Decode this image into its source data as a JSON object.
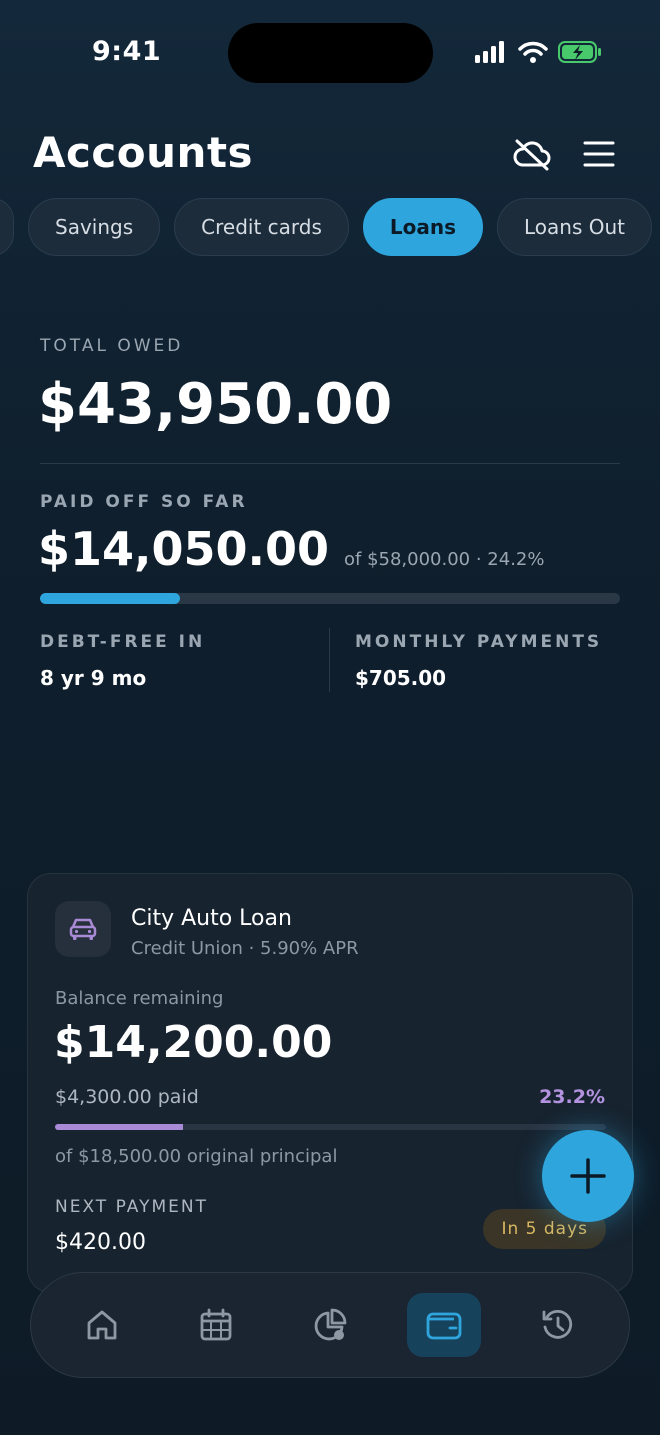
{
  "status_bar": {
    "time": "9:41"
  },
  "header": {
    "title": "Accounts"
  },
  "tabs": [
    {
      "label": ""
    },
    {
      "label": "Savings"
    },
    {
      "label": "Credit cards"
    },
    {
      "label": "Loans",
      "active": true
    },
    {
      "label": "Loans Out"
    }
  ],
  "summary": {
    "total_label": "TOTAL OWED",
    "total_value": "$43,950.00",
    "paid_label": "PAID OFF SO FAR",
    "paid_value": "$14,050.00",
    "paid_meta": "of $58,000.00 · 24.2%",
    "paid_progress": 0.242,
    "debt_free_label": "DEBT-FREE IN",
    "debt_free_value": "8 yr 9 mo",
    "monthly_label": "MONTHLY PAYMENTS",
    "monthly_value": "$705.00"
  },
  "loan": {
    "name": "City Auto Loan",
    "subtitle": "Credit Union · 5.90% APR",
    "balance_label": "Balance remaining",
    "balance_value": "$14,200.00",
    "paid_amount": "$4,300.00 paid",
    "paid_percent": "23.2%",
    "paid_progress": 0.232,
    "principal": "of $18,500.00 original principal",
    "next_label": "NEXT PAYMENT",
    "next_value": "$420.00",
    "due_badge": "In 5 days"
  },
  "nav": [
    {
      "icon": "home-icon"
    },
    {
      "icon": "calendar-icon"
    },
    {
      "icon": "pie-chart-icon"
    },
    {
      "icon": "wallet-icon",
      "active": true
    },
    {
      "icon": "history-icon"
    }
  ],
  "colors": {
    "accent": "#2ea6dd",
    "loan_accent": "#a98ad6",
    "badge_text": "#d9b862"
  }
}
